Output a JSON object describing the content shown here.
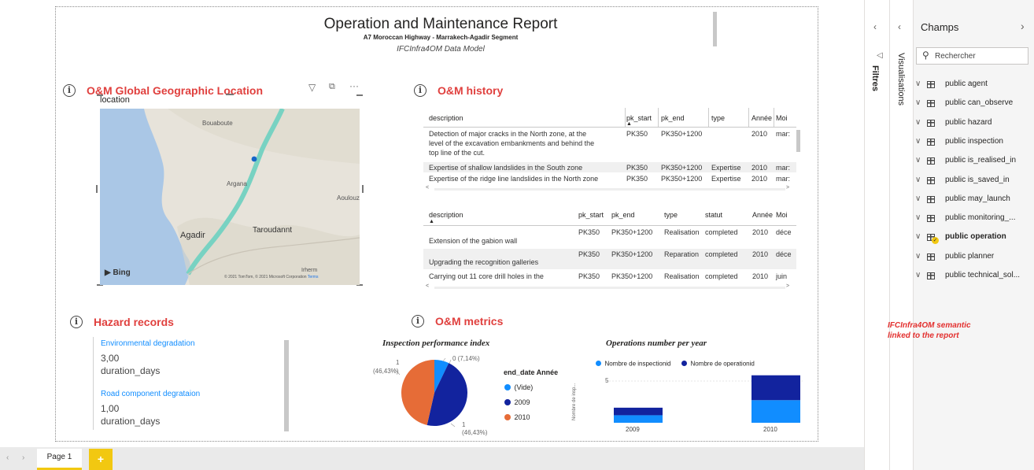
{
  "report": {
    "title": "Operation and Maintenance Report",
    "subtitle": "A7 Moroccan Highway - Marrakech-Agadir Segment",
    "model": "IFCInfra4OM Data Model"
  },
  "sections": {
    "geo": "O&M Global Geographic Location",
    "history": "O&M history",
    "hazard": "Hazard records",
    "metrics": "O&M metrics"
  },
  "map": {
    "label": "location",
    "places": [
      "Bouaboute",
      "Argana",
      "Aoulouz",
      "Agadir",
      "Taroudannt",
      "Irherm"
    ],
    "provider": "Bing",
    "copyright": "© 2021 TomTom, © 2021 Microsoft Corporation",
    "terms": "Terms"
  },
  "table1": {
    "headers": [
      "description",
      "pk_start",
      "pk_end",
      "type",
      "Année",
      "Moi"
    ],
    "rows": [
      {
        "description": [
          "Detection of major cracks in the North zone, at the",
          "level of the excavation embankments and behind the",
          "top line of the cut."
        ],
        "pk_start": "PK350",
        "pk_end": "PK350+1200",
        "type": "",
        "annee": "2010",
        "mois": "mar:"
      },
      {
        "description": [
          "Expertise of shallow landslides in the South zone"
        ],
        "pk_start": "PK350",
        "pk_end": "PK350+1200",
        "type": "Expertise",
        "annee": "2010",
        "mois": "mar:"
      },
      {
        "description": [
          "Expertise of the ridge line landslides in the North zone"
        ],
        "pk_start": "PK350",
        "pk_end": "PK350+1200",
        "type": "Expertise",
        "annee": "2010",
        "mois": "mar:"
      }
    ]
  },
  "table2": {
    "headers": [
      "description",
      "pk_start",
      "pk_end",
      "type",
      "statut",
      "Année",
      "Moi"
    ],
    "rows": [
      {
        "description": "Extension of the gabion wall",
        "pk_start": "PK350",
        "pk_end": "PK350+1200",
        "type": "Realisation",
        "statut": "completed",
        "annee": "2010",
        "mois": "déce"
      },
      {
        "description": "Upgrading the recognition galleries",
        "pk_start": "PK350",
        "pk_end": "PK350+1200",
        "type": "Reparation",
        "statut": "completed",
        "annee": "2010",
        "mois": "déce"
      },
      {
        "description": "Carrying out 11 core drill holes in the",
        "pk_start": "PK350",
        "pk_end": "PK350+1200",
        "type": "Realisation",
        "statut": "completed",
        "annee": "2010",
        "mois": "juin"
      }
    ]
  },
  "hazards": [
    {
      "name": "Environmental degradation",
      "value": "3,00",
      "unit": "duration_days"
    },
    {
      "name": "Road component degrataion",
      "value": "1,00",
      "unit": "duration_days"
    }
  ],
  "chart_data": [
    {
      "type": "pie",
      "title": "Inspection performance index",
      "legend_title": "end_date Année",
      "series": [
        {
          "name": "(Vide)",
          "value": 1,
          "percent": "7,14%",
          "color": "#118dff"
        },
        {
          "name": "2009",
          "value": 6.5,
          "percent": "46,43%",
          "color": "#12239e"
        },
        {
          "name": "2010",
          "value": 6.5,
          "percent": "46,43%",
          "color": "#e66c37"
        }
      ],
      "labels": [
        "0 (7,14%)",
        "1",
        "(46,43%)",
        "1",
        "(46,43%)"
      ]
    },
    {
      "type": "bar",
      "title": "Operations number per year",
      "categories": [
        "2009",
        "2010"
      ],
      "series": [
        {
          "name": "Nombre de inspectionid",
          "values": [
            1,
            3
          ],
          "color": "#118dff"
        },
        {
          "name": "Nombre de operationid",
          "values": [
            1,
            3.3
          ],
          "color": "#12239e"
        }
      ],
      "ylabel": "Nombre de insp...",
      "ytick": "5",
      "ylim": [
        0,
        7
      ]
    }
  ],
  "filters_label": "Filtres",
  "visualisations_label": "Visualisations",
  "fields": {
    "title": "Champs",
    "search_placeholder": "Rechercher",
    "items": [
      "public agent",
      "public can_observe",
      "public hazard",
      "public inspection",
      "public is_realised_in",
      "public is_saved_in",
      "public may_launch",
      "public monitoring_...",
      "public operation",
      "public planner",
      "public technical_sol..."
    ]
  },
  "annotation": [
    "IFCInfra4OM semantic",
    "linked to the report"
  ],
  "pages": {
    "tab": "Page 1",
    "add": "+"
  }
}
